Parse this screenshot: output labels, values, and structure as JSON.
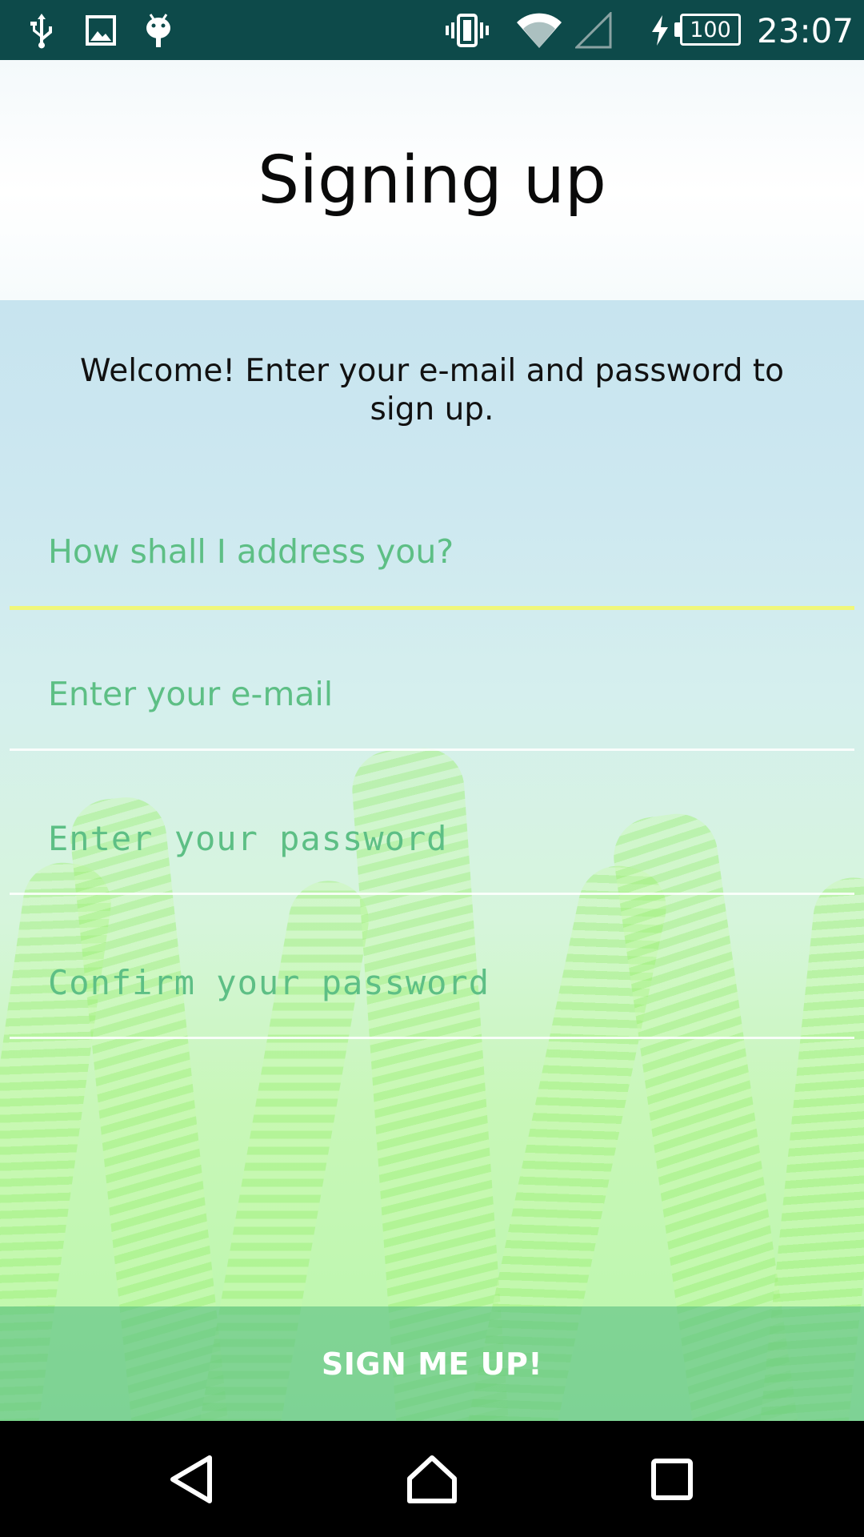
{
  "status_bar": {
    "time": "23:07",
    "battery_level": "100",
    "left_icons": [
      "usb-icon",
      "image-icon",
      "android-debug-icon"
    ],
    "right_icons": [
      "vibrate-icon",
      "wifi-icon",
      "cell-signal-icon",
      "charging-icon",
      "battery-icon"
    ],
    "background_color": "#0d4a4a"
  },
  "header": {
    "title": "Signing up"
  },
  "form": {
    "welcome_text": "Welcome! Enter your e-mail and password to sign up.",
    "name_field": {
      "placeholder": "How shall I address you?",
      "value": ""
    },
    "email_field": {
      "placeholder": "Enter your e-mail",
      "value": ""
    },
    "password_field": {
      "placeholder": "Enter your password",
      "value": ""
    },
    "confirm_password_field": {
      "placeholder": "Confirm your password",
      "value": ""
    },
    "submit_label": "SIGN ME UP!",
    "accent_color": "#5dbf85",
    "focus_underline_color": "#f0f77a"
  },
  "nav_bar": {
    "buttons": [
      "back-icon",
      "home-icon",
      "recents-icon"
    ]
  }
}
